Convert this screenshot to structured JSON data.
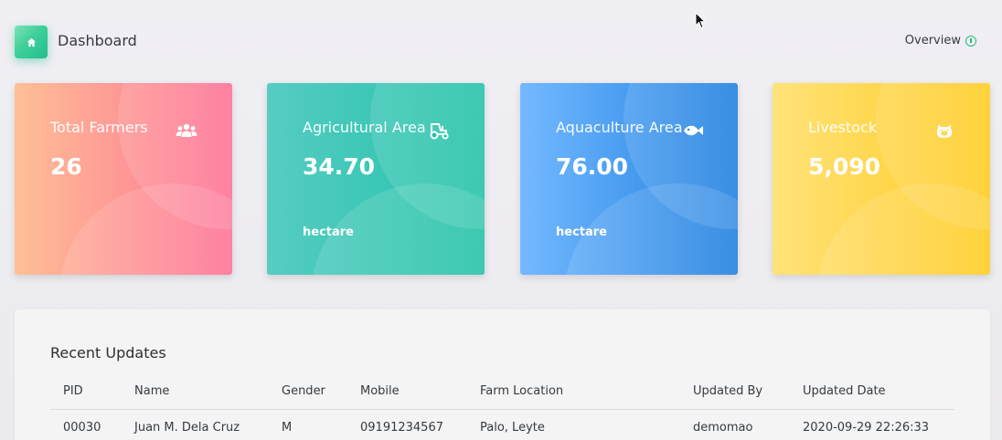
{
  "header": {
    "title": "Dashboard",
    "home_icon": "home-icon",
    "overview_label": "Overview",
    "overview_icon": "info-circle-icon"
  },
  "cards": [
    {
      "label": "Total Farmers",
      "value": "26",
      "unit": "",
      "icon": "users-icon",
      "gradient": [
        "#ffbf96",
        "#fe7096"
      ]
    },
    {
      "label": "Agricultural Area",
      "value": "34.70",
      "unit": "hectare",
      "icon": "tractor-icon",
      "gradient": [
        "#56ccc3",
        "#22c2a8"
      ]
    },
    {
      "label": "Aquaculture Area",
      "value": "76.00",
      "unit": "hectare",
      "icon": "fish-icon",
      "gradient": [
        "#74b9ff",
        "#1e7fe0"
      ]
    },
    {
      "label": "Livestock",
      "value": "5,090",
      "unit": "",
      "icon": "pig-icon",
      "gradient": [
        "#ffe27a",
        "#ffcc22"
      ]
    }
  ],
  "recent_updates": {
    "title": "Recent Updates",
    "columns": [
      "PID",
      "Name",
      "Gender",
      "Mobile",
      "Farm Location",
      "Updated By",
      "Updated Date"
    ],
    "rows": [
      [
        "00030",
        "Juan M. Dela Cruz",
        "M",
        "09191234567",
        "Palo, Leyte",
        "demomao",
        "2020-09-29 22:26:33"
      ]
    ]
  }
}
